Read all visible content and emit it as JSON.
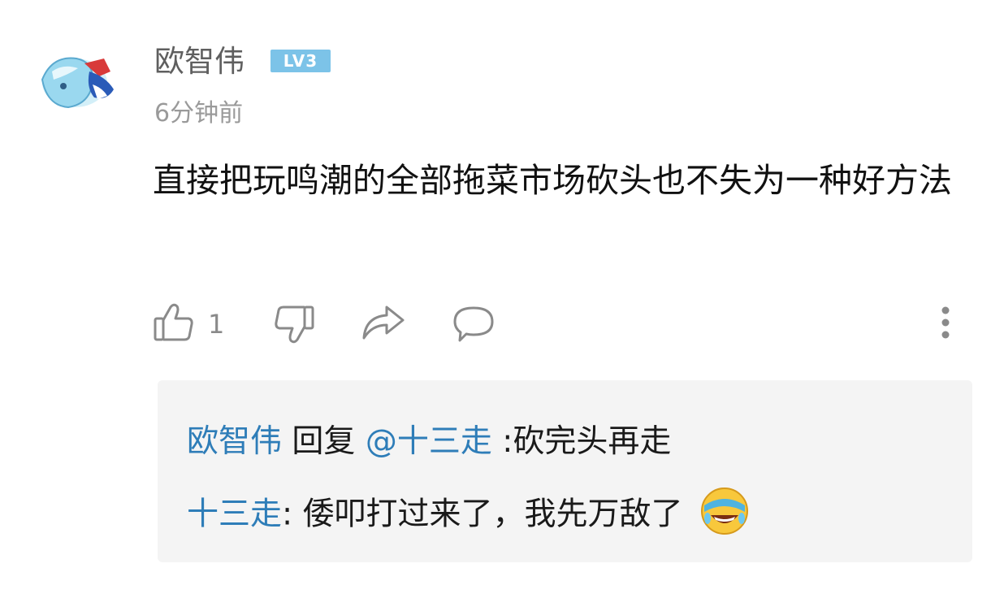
{
  "comment": {
    "username": "欧智伟",
    "level": "LV3",
    "time": "6分钟前",
    "text": "直接把玩鸣潮的全部拖菜市场砍头也不失为一种好方法",
    "like_count": "1"
  },
  "replies": [
    {
      "author": "欧智伟",
      "action": "回复",
      "mention": "@十三走",
      "text": ":砍完头再走"
    },
    {
      "author": "十三走",
      "separator": ":",
      "text": " 倭叩打过来了，我先万敌了"
    }
  ],
  "icons": {
    "like": "thumbs-up-icon",
    "dislike": "thumbs-down-icon",
    "share": "share-icon",
    "comment": "comment-icon",
    "more": "more-vertical-icon",
    "emoji": "laughing-crying-emoji-icon"
  },
  "colors": {
    "link_blue": "#2e7db8",
    "level_badge": "#7cc3e8",
    "reply_bg": "#f4f4f4"
  }
}
